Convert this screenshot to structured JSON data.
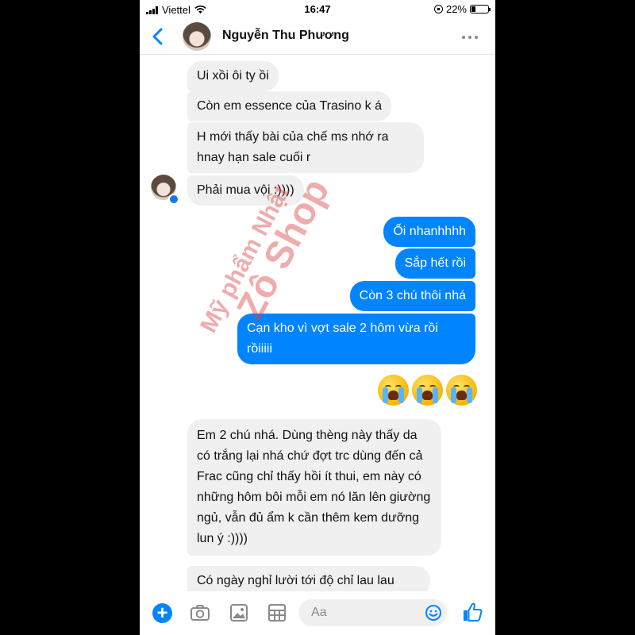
{
  "status_bar": {
    "carrier": "Viettel",
    "time": "16:47",
    "battery_percent": "22%"
  },
  "header": {
    "contact_name": "Nguyễn Thu Phương"
  },
  "messages": [
    {
      "dir": "in",
      "text": "Ui xồi ôi ty ồi"
    },
    {
      "dir": "in",
      "text": "Còn em essence của Trasino k á"
    },
    {
      "dir": "in",
      "text": "H mới thấy bài của chế ms nhớ ra hnay hạn sale cuối r"
    },
    {
      "dir": "in",
      "text": "Phải mua vội :))))"
    },
    {
      "dir": "out",
      "text": "Ối nhanhhhh"
    },
    {
      "dir": "out",
      "text": "Sắp hết rồi"
    },
    {
      "dir": "out",
      "text": "Còn 3 chú thôi nhá"
    },
    {
      "dir": "out",
      "text": "Cạn kho vì vợt sale 2 hôm vừa rồi rồiiiii"
    },
    {
      "dir": "in",
      "text": "Em 2 chú nhá. Dùng thèng này thấy da có trắng lại nhá chứ đợt trc dùng đến cả Frac cũng chỉ thấy hồi ít thui, em này có những hôm bôi mỗi em nó lăn lên giường ngủ, vẫn đủ ẩm k cần thêm kem dưỡng lun ý :))))"
    },
    {
      "dir": "in",
      "text": "Có ngày nghỉ lười tới độ chỉ lau lau"
    }
  ],
  "emoji_reaction": [
    "crying-face",
    "crying-face",
    "crying-face"
  ],
  "watermark": {
    "line1": "Mỹ phẩm Nhật",
    "line2": "Zô Shop"
  },
  "composer": {
    "placeholder": "Aa"
  },
  "colors": {
    "outgoing_bubble": "#0084ff",
    "incoming_bubble": "#f0f0f0",
    "accent": "#0084ff"
  }
}
